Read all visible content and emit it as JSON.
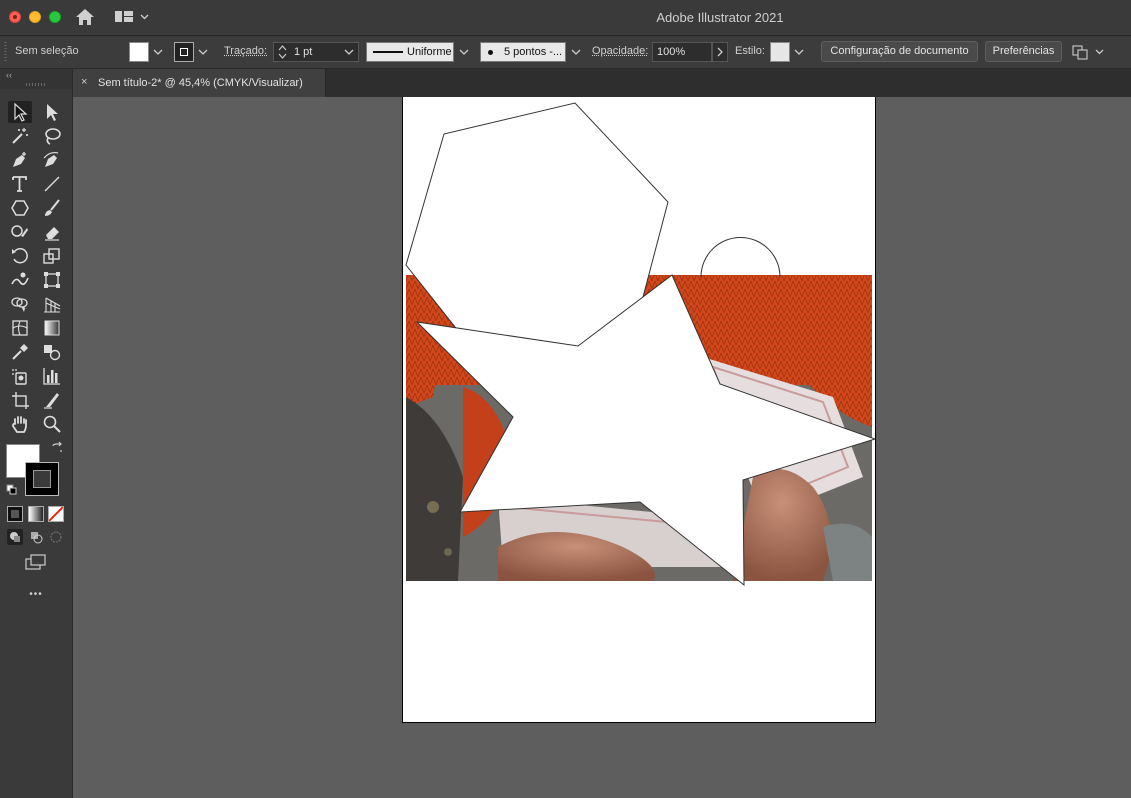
{
  "window": {
    "title": "Adobe Illustrator 2021"
  },
  "control_bar": {
    "selection_label": "Sem seleção",
    "stroke_label": "Traçado:",
    "stroke_weight": "1 pt",
    "stroke_profile": "Uniforme",
    "brush_label": "5 pontos -...",
    "opacity_label": "Opacidade:",
    "opacity_value": "100%",
    "style_label": "Estilo:",
    "document_setup_button": "Configuração de documento",
    "preferences_button": "Preferências"
  },
  "document_tab": {
    "close_glyph": "×",
    "label": "Sem título-2* @ 45,4% (CMYK/Visualizar)"
  },
  "toolbar": {
    "collapse_glyph": "‹‹",
    "more_glyph": "•••",
    "tools": [
      "selection-tool-icon",
      "direct-selection-tool-icon",
      "magic-wand-tool-icon",
      "lasso-tool-icon",
      "pen-tool-icon",
      "curvature-tool-icon",
      "type-tool-icon",
      "line-segment-tool-icon",
      "polygon-tool-icon",
      "paintbrush-tool-icon",
      "shaper-tool-icon",
      "eraser-tool-icon",
      "rotate-tool-icon",
      "scale-tool-icon",
      "warp-tool-icon",
      "free-transform-tool-icon",
      "shape-builder-tool-icon",
      "perspective-grid-tool-icon",
      "mesh-tool-icon",
      "gradient-tool-icon",
      "eyedropper-tool-icon",
      "blend-tool-icon",
      "symbol-sprayer-tool-icon",
      "column-graph-tool-icon",
      "artboard-tool-icon",
      "slice-tool-icon",
      "hand-tool-icon",
      "zoom-tool-icon"
    ]
  },
  "colors": {
    "fill": "#ffffff",
    "stroke": "#000000",
    "canvas_bg": "#5e5e5e",
    "sweater_orange": "#d2481c"
  }
}
